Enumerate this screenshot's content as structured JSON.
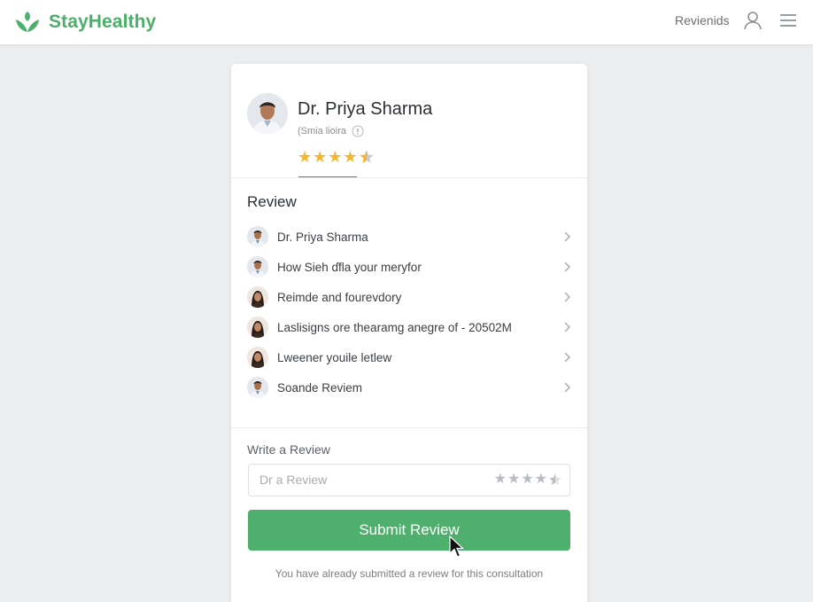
{
  "header": {
    "brand_name": "StayHealthy",
    "nav_link": "Revienids",
    "icons": {
      "logo": "leaf-logo-icon",
      "user": "user-icon",
      "menu": "menu-icon"
    },
    "brand_color": "#4caf6a"
  },
  "doctor": {
    "name": "Dr. Priya Sharma",
    "subtitle": "(Smia lioira",
    "rating": 4.5
  },
  "reviews": {
    "title": "Review",
    "items": [
      {
        "label": "Dr. Priya Sharma",
        "avatar": "male"
      },
      {
        "label": "How Sieh ɗfla your meryfor",
        "avatar": "male"
      },
      {
        "label": "Reimde and fourevdory",
        "avatar": "female"
      },
      {
        "label": "Laslisigns ore thearamg anegre of - 20502M",
        "avatar": "female"
      },
      {
        "label": "Lweener youile letlew",
        "avatar": "female"
      },
      {
        "label": "Soande Reviem",
        "avatar": "male"
      }
    ]
  },
  "write_review": {
    "label": "Write a Review",
    "placeholder": "Dr a Review",
    "rating": 4.5
  },
  "submit": {
    "label": "Submit Review",
    "color": "#4fb06d"
  },
  "notice": "You have already submitted a review for this consultation"
}
